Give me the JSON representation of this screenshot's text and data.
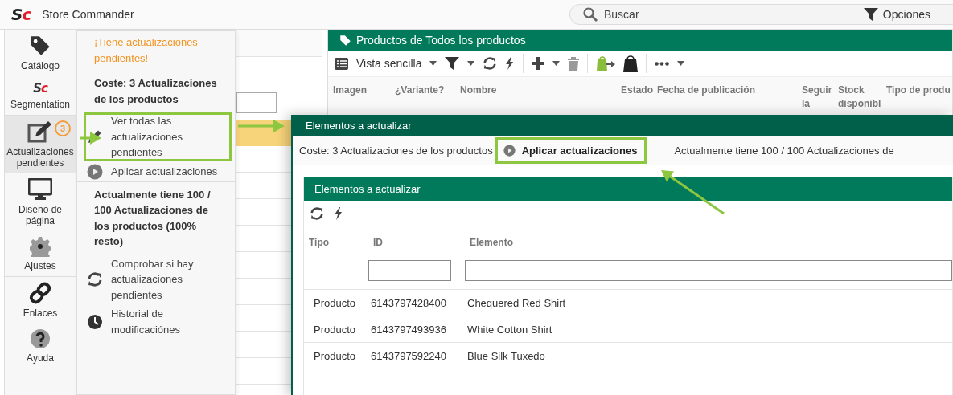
{
  "app": {
    "logo": "Sc",
    "title": "Store Commander"
  },
  "search": {
    "placeholder": "Buscar"
  },
  "options_button": {
    "label": "Opciones"
  },
  "sidebar": {
    "items": [
      {
        "label": "Catálogo",
        "selected": false
      },
      {
        "label": "Segmentation",
        "selected": false,
        "logo": "Sc"
      },
      {
        "label": "Actualizaciones pendientes",
        "selected": true,
        "badge": "3"
      },
      {
        "label": "Diseño de página",
        "selected": false
      },
      {
        "label": "Ajustes",
        "selected": false
      },
      {
        "label": "Enlaces",
        "selected": false
      },
      {
        "label": "Ayuda",
        "selected": false
      }
    ]
  },
  "updates_menu": {
    "entries": [
      {
        "kind": "alert",
        "text": "¡Tiene actualizaciones pendientes!"
      },
      {
        "kind": "heading",
        "text": "Coste: 3 Actualizaciones de los productos"
      },
      {
        "kind": "action",
        "label": "Ver todas las actualizaciones pendientes",
        "highlighted": true
      },
      {
        "kind": "action",
        "label": "Aplicar actualizaciones",
        "highlighted": false
      },
      {
        "kind": "heading",
        "text": "Actualmente tiene 100 / 100 Actualizaciones de los productos (100% resto)"
      },
      {
        "kind": "action",
        "label": "Comprobar si hay actualizaciones pendientes",
        "highlighted": false
      },
      {
        "kind": "action",
        "label": "Historial de modificaciónes",
        "highlighted": false
      }
    ]
  },
  "products_panel": {
    "title": "Productos de Todos los productos",
    "view_select": "Vista sencilla",
    "columns": [
      "Imagen",
      "¿Variante?",
      "Nombre",
      "Estado",
      "Fecha de publicación",
      "Seguir la",
      "Stock disponibl",
      "Tipo de produ"
    ]
  },
  "dialog": {
    "title": "Elementos a actualizar",
    "cost": "Coste: 3 Actualizaciones de los productos",
    "apply_button": {
      "label": "Aplicar actualizaciones",
      "highlighted": true
    },
    "quota": "Actualmente tiene 100 / 100 Actualizaciones de",
    "items_panel": {
      "title": "Elementos a actualizar",
      "columns": [
        "Tipo",
        "ID",
        "Elemento"
      ],
      "rows": [
        [
          "Producto",
          "6143797428400",
          "Chequered Red Shirt"
        ],
        [
          "Producto",
          "6143797493936",
          "White Cotton Shirt"
        ],
        [
          "Producto",
          "6143797592240",
          "Blue Silk Tuxedo"
        ]
      ]
    }
  }
}
